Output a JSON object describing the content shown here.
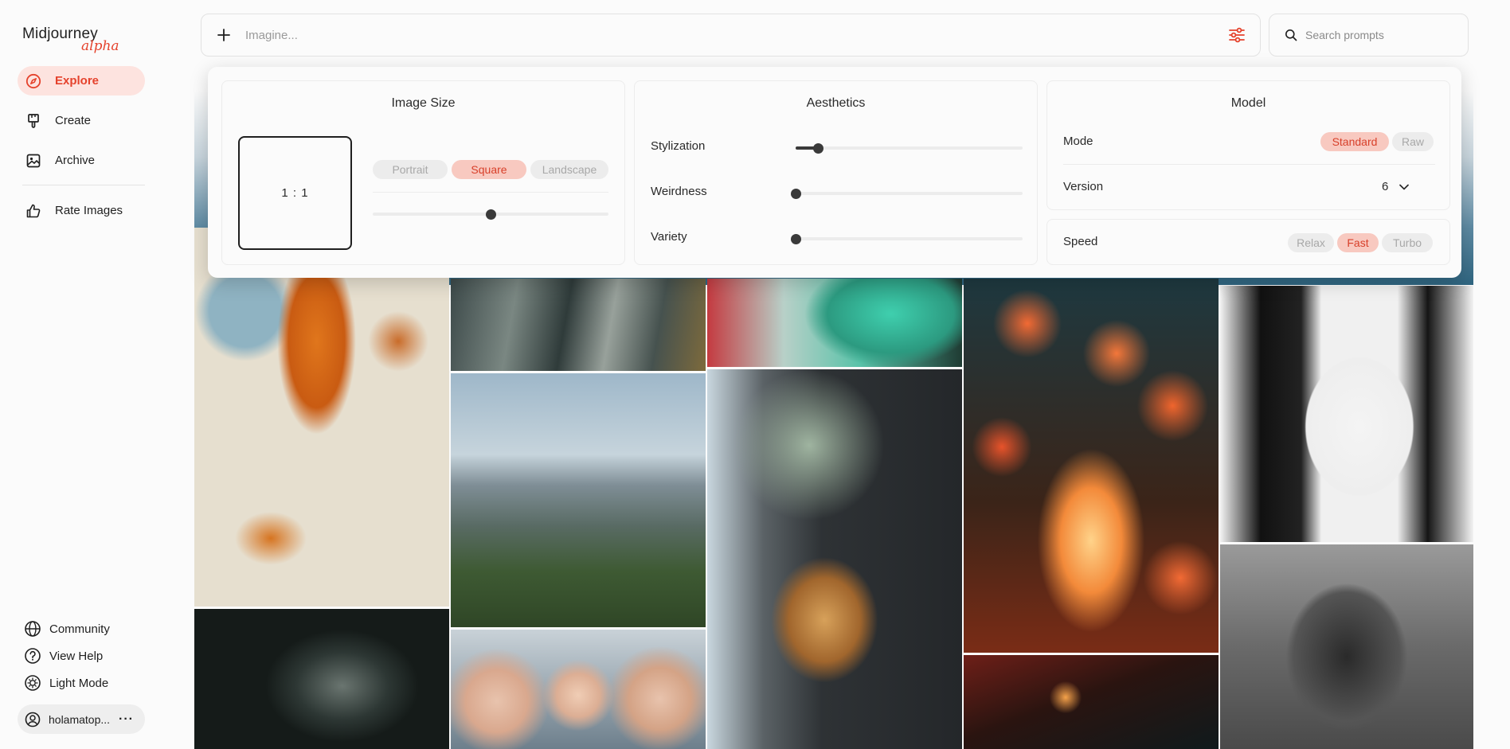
{
  "sidebar": {
    "brand": "Midjourney",
    "brand_tag": "alpha",
    "nav": [
      {
        "label": "Explore",
        "icon": "compass-icon",
        "active": true
      },
      {
        "label": "Create",
        "icon": "brush-icon",
        "active": false
      },
      {
        "label": "Archive",
        "icon": "image-icon",
        "active": false
      },
      {
        "label": "Rate Images",
        "icon": "thumbs-up-icon",
        "active": false
      }
    ],
    "bottom": [
      {
        "label": "Community",
        "icon": "globe-icon"
      },
      {
        "label": "View Help",
        "icon": "help-icon"
      },
      {
        "label": "Light Mode",
        "icon": "sun-icon"
      }
    ],
    "user": {
      "name": "holamatop...",
      "menu": "···"
    }
  },
  "imagine": {
    "placeholder": "Imagine..."
  },
  "search": {
    "placeholder": "Search prompts"
  },
  "settings": {
    "image_size": {
      "title": "Image Size",
      "ratio": "1 : 1",
      "orientations": [
        "Portrait",
        "Square",
        "Landscape"
      ],
      "selected": "Square",
      "slider_value": 0.5
    },
    "aesthetics": {
      "title": "Aesthetics",
      "sliders": [
        {
          "label": "Stylization",
          "value": 0.1
        },
        {
          "label": "Weirdness",
          "value": 0
        },
        {
          "label": "Variety",
          "value": 0
        }
      ]
    },
    "model": {
      "title": "Model",
      "mode_label": "Mode",
      "modes": [
        "Standard",
        "Raw"
      ],
      "mode_selected": "Standard",
      "version_label": "Version",
      "version_value": "6",
      "speed_label": "Speed",
      "speeds": [
        "Relax",
        "Fast",
        "Turbo"
      ],
      "speed_selected": "Fast"
    }
  },
  "colors": {
    "accent": "#e5422c",
    "accent_bg": "#fde3df",
    "pill_active_bg": "#f8c9c0"
  }
}
